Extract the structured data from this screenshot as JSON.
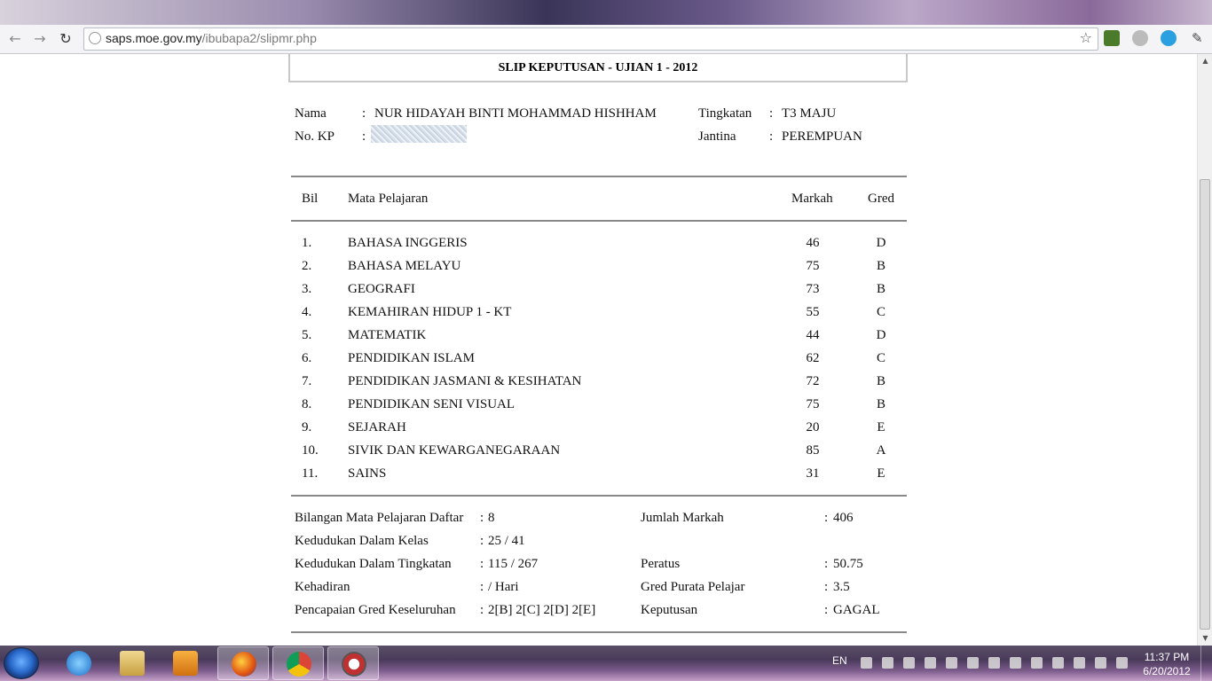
{
  "browser": {
    "url_host": "saps.moe.gov.my",
    "url_path": "/ibubapa2/slipmr.php"
  },
  "slip": {
    "title": "SLIP KEPUTUSAN - UJIAN 1 - 2012",
    "info": {
      "nama_label": "Nama",
      "nama_value": "NUR HIDAYAH BINTI MOHAMMAD HISHHAM",
      "nokp_label": "No. KP",
      "tingkatan_label": "Tingkatan",
      "tingkatan_value": "T3 MAJU",
      "jantina_label": "Jantina",
      "jantina_value": "PEREMPUAN",
      "sep": ":"
    },
    "table_headers": {
      "bil": "Bil",
      "subject": "Mata Pelajaran",
      "markah": "Markah",
      "gred": "Gred"
    },
    "rows": [
      {
        "bil": "1.",
        "subject": "BAHASA INGGERIS",
        "markah": "46",
        "gred": "D"
      },
      {
        "bil": "2.",
        "subject": "BAHASA MELAYU",
        "markah": "75",
        "gred": "B"
      },
      {
        "bil": "3.",
        "subject": "GEOGRAFI",
        "markah": "73",
        "gred": "B"
      },
      {
        "bil": "4.",
        "subject": "KEMAHIRAN HIDUP 1 - KT",
        "markah": "55",
        "gred": "C"
      },
      {
        "bil": "5.",
        "subject": "MATEMATIK",
        "markah": "44",
        "gred": "D"
      },
      {
        "bil": "6.",
        "subject": "PENDIDIKAN ISLAM",
        "markah": "62",
        "gred": "C"
      },
      {
        "bil": "7.",
        "subject": "PENDIDIKAN JASMANI & KESIHATAN",
        "markah": "72",
        "gred": "B"
      },
      {
        "bil": "8.",
        "subject": "PENDIDIKAN SENI VISUAL",
        "markah": "75",
        "gred": "B"
      },
      {
        "bil": "9.",
        "subject": "SEJARAH",
        "markah": "20",
        "gred": "E"
      },
      {
        "bil": "10.",
        "subject": "SIVIK DAN KEWARGANEGARAAN",
        "markah": "85",
        "gred": "A"
      },
      {
        "bil": "11.",
        "subject": "SAINS",
        "markah": "31",
        "gred": "E"
      }
    ],
    "summary_left": [
      {
        "label": "Bilangan Mata Pelajaran Daftar",
        "value": "8"
      },
      {
        "label": "Kedudukan Dalam Kelas",
        "value": "25 / 41"
      },
      {
        "label": "Kedudukan Dalam Tingkatan",
        "value": "115 / 267"
      },
      {
        "label": "Kehadiran",
        "value": "/ Hari"
      },
      {
        "label": "Pencapaian Gred Keseluruhan",
        "value": "2[B] 2[C] 2[D] 2[E]"
      }
    ],
    "summary_right": [
      {
        "label": "Jumlah Markah",
        "value": "406"
      },
      {
        "label": "Peratus",
        "value": "50.75"
      },
      {
        "label": "Gred Purata Pelajar",
        "value": "3.5"
      },
      {
        "label": "Keputusan",
        "value": "GAGAL"
      }
    ]
  },
  "taskbar": {
    "lang": "EN",
    "time": "11:37 PM",
    "date": "6/20/2012"
  }
}
